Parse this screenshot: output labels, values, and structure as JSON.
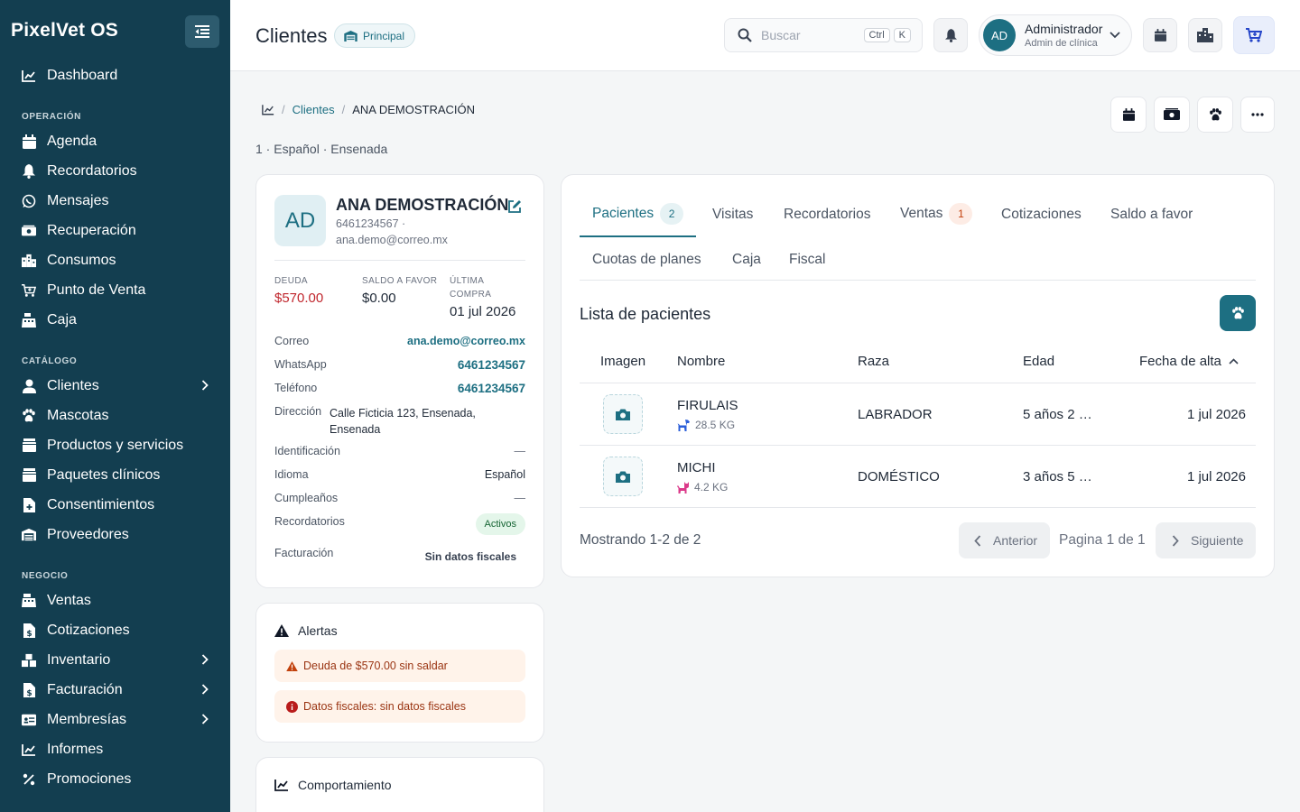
{
  "app": {
    "brand": "PixelVet OS"
  },
  "sidebar": {
    "items": [
      {
        "label": "Dashboard",
        "icon": "chart-line-icon"
      },
      {
        "section": "OPERACIÓN"
      },
      {
        "label": "Agenda",
        "icon": "calendar-icon"
      },
      {
        "label": "Recordatorios",
        "icon": "bell-icon"
      },
      {
        "label": "Mensajes",
        "icon": "whatsapp-icon"
      },
      {
        "label": "Recuperación",
        "icon": "money-icon"
      },
      {
        "label": "Consumos",
        "icon": "building-icon"
      },
      {
        "label": "Punto de Venta",
        "icon": "cart-icon"
      },
      {
        "label": "Caja",
        "icon": "cash-register-icon"
      },
      {
        "section": "CATÁLOGO"
      },
      {
        "label": "Clientes",
        "icon": "user-icon",
        "active": true,
        "expandable": true
      },
      {
        "label": "Mascotas",
        "icon": "paw-icon"
      },
      {
        "label": "Productos y servicios",
        "icon": "box-icon"
      },
      {
        "label": "Paquetes clínicos",
        "icon": "package-icon"
      },
      {
        "label": "Consentimientos",
        "icon": "file-icon"
      },
      {
        "label": "Proveedores",
        "icon": "warehouse-icon"
      },
      {
        "section": "NEGOCIO"
      },
      {
        "label": "Ventas",
        "icon": "register-icon"
      },
      {
        "label": "Cotizaciones",
        "icon": "invoice-icon"
      },
      {
        "label": "Inventario",
        "icon": "boxes-icon",
        "expandable": true
      },
      {
        "label": "Facturación",
        "icon": "receipt-icon",
        "expandable": true
      },
      {
        "label": "Membresías",
        "icon": "id-card-icon",
        "expandable": true
      },
      {
        "label": "Informes",
        "icon": "report-icon"
      },
      {
        "label": "Promociones",
        "icon": "percent-icon"
      }
    ]
  },
  "header": {
    "title": "Clientes",
    "branch": "Principal",
    "search_placeholder": "Buscar",
    "kbd_ctrl": "Ctrl",
    "kbd_k": "K",
    "user_initials": "AD",
    "user_name": "Administrador",
    "user_role": "Admin de clínica"
  },
  "breadcrumb": {
    "link": "Clientes",
    "current": "ANA DEMOSTRACIÓN"
  },
  "subline": "1 · Español · Ensenada",
  "profile": {
    "initials": "AD",
    "name": "ANA DEMOSTRACIÓN",
    "contact": "6461234567 · ana.demo@correo.mx",
    "stats": [
      {
        "label": "DEUDA",
        "value": "$570.00"
      },
      {
        "label": "SALDO A FAVOR",
        "value": "$0.00"
      },
      {
        "label": "ÚLTIMA COMPRA",
        "value": "01 jul 2026"
      }
    ],
    "rows": {
      "correo_label": "Correo",
      "correo": "ana.demo@correo.mx",
      "whatsapp_label": "WhatsApp",
      "whatsapp": "6461234567",
      "telefono_label": "Teléfono",
      "telefono": "6461234567",
      "direccion_label": "Dirección",
      "direccion": "Calle Ficticia 123, Ensenada, Ensenada",
      "identificacion_label": "Identificación",
      "identificacion": "—",
      "idioma_label": "Idioma",
      "idioma": "Español",
      "cumple_label": "Cumpleaños",
      "cumple": "—",
      "recordatorios_label": "Recordatorios",
      "recordatorios": "Activos",
      "facturacion_label": "Facturación",
      "facturacion": "Sin datos fiscales"
    }
  },
  "alerts": {
    "title": "Alertas",
    "items": [
      "Deuda de $570.00 sin saldar",
      "Datos fiscales: sin datos fiscales"
    ]
  },
  "behavior": {
    "title": "Comportamiento"
  },
  "tabs": [
    {
      "label": "Pacientes",
      "count": "2"
    },
    {
      "label": "Visitas"
    },
    {
      "label": "Recordatorios"
    },
    {
      "label": "Ventas",
      "count": "1"
    },
    {
      "label": "Cotizaciones"
    },
    {
      "label": "Saldo a favor"
    },
    {
      "label": "Cuotas de planes"
    },
    {
      "label": "Caja"
    },
    {
      "label": "Fiscal"
    }
  ],
  "patients": {
    "title": "Lista de pacientes",
    "columns": [
      "Imagen",
      "Nombre",
      "Raza",
      "Edad",
      "Fecha de alta"
    ],
    "rows": [
      {
        "name": "FIRULAIS",
        "weight": "28.5 KG",
        "species_icon": "dog-icon",
        "breed": "LABRADOR",
        "age": "5 años 2 …",
        "date": "1 jul 2026"
      },
      {
        "name": "MICHI",
        "weight": "4.2 KG",
        "species_icon": "cat-icon",
        "breed": "DOMÉSTICO",
        "age": "3 años 5 …",
        "date": "1 jul 2026"
      }
    ],
    "showing": "Mostrando 1-2 de 2",
    "prev": "Anterior",
    "page": "Pagina 1 de 1",
    "next": "Siguiente"
  },
  "colors": {
    "sidebar": "#133e50",
    "accent": "#1d6f82",
    "debt": "#c0262d"
  }
}
